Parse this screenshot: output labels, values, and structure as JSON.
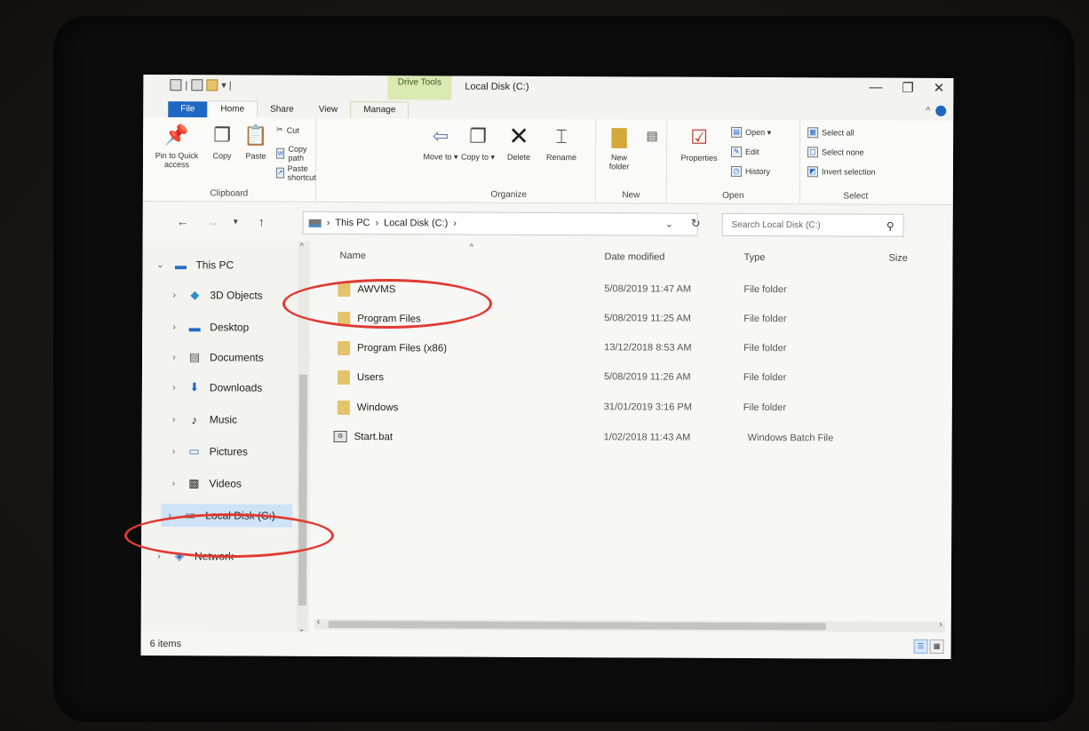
{
  "window": {
    "title": "Local Disk (C:)",
    "contextual_tab_group": "Drive Tools",
    "minimize": "—",
    "maximize": "❐",
    "close": "✕"
  },
  "tabs": [
    {
      "label": "File"
    },
    {
      "label": "Home"
    },
    {
      "label": "Share"
    },
    {
      "label": "View"
    },
    {
      "label": "Manage"
    }
  ],
  "ribbon": {
    "clipboard": {
      "label": "Clipboard",
      "pin": "Pin to Quick access",
      "copy": "Copy",
      "paste": "Paste",
      "cut": "Cut",
      "copy_path": "Copy path",
      "paste_shortcut": "Paste shortcut"
    },
    "organize": {
      "label": "Organize",
      "move_to": "Move to ▾",
      "copy_to": "Copy to ▾",
      "delete": "Delete",
      "rename": "Rename"
    },
    "new": {
      "label": "New",
      "new_folder": "New folder"
    },
    "open": {
      "label": "Open",
      "properties": "Properties",
      "open": "Open ▾",
      "edit": "Edit",
      "history": "History"
    },
    "select": {
      "label": "Select",
      "select_all": "Select all",
      "select_none": "Select none",
      "invert": "Invert selection"
    }
  },
  "address": {
    "crumbs": [
      "This PC",
      "Local Disk (C:)"
    ],
    "search_placeholder": "Search Local Disk (C:)"
  },
  "navpane": {
    "items": [
      {
        "label": "This PC",
        "icon": "monitor-icon"
      },
      {
        "label": "3D Objects",
        "icon": "cube-icon"
      },
      {
        "label": "Desktop",
        "icon": "desktop-icon"
      },
      {
        "label": "Documents",
        "icon": "document-icon"
      },
      {
        "label": "Downloads",
        "icon": "download-icon"
      },
      {
        "label": "Music",
        "icon": "music-icon"
      },
      {
        "label": "Pictures",
        "icon": "picture-icon"
      },
      {
        "label": "Videos",
        "icon": "video-icon"
      },
      {
        "label": "Local Disk (C:)",
        "icon": "drive-icon"
      },
      {
        "label": "Network",
        "icon": "network-icon"
      }
    ]
  },
  "columns": {
    "name": "Name",
    "date": "Date modified",
    "type": "Type",
    "size": "Size"
  },
  "files": [
    {
      "name": "AWVMS",
      "date": "5/08/2019 11:47 AM",
      "type": "File folder"
    },
    {
      "name": "Program Files",
      "date": "5/08/2019 11:25 AM",
      "type": "File folder"
    },
    {
      "name": "Program Files (x86)",
      "date": "13/12/2018 8:53 AM",
      "type": "File folder"
    },
    {
      "name": "Users",
      "date": "5/08/2019 11:26 AM",
      "type": "File folder"
    },
    {
      "name": "Windows",
      "date": "31/01/2019 3:16 PM",
      "type": "File folder"
    },
    {
      "name": "Start.bat",
      "date": "1/02/2018 11:43 AM",
      "type": "Windows Batch File"
    }
  ],
  "status": {
    "item_count": "6 items"
  },
  "colors": {
    "annotation": "#e03a32",
    "accent": "#1f68c1"
  }
}
